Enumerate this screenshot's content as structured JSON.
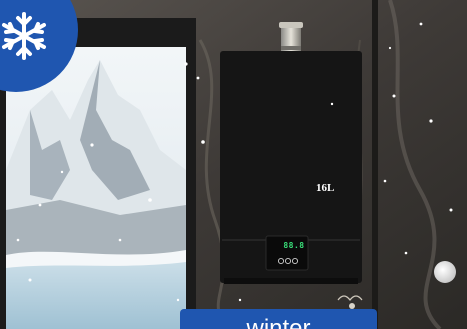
{
  "caption": {
    "label": "winter"
  },
  "heater": {
    "capacity_label": "16L",
    "display_readout": "88.8"
  },
  "badge": {
    "icon": "snowflake-icon",
    "color": "#1f56b0"
  },
  "colors": {
    "sky": "#e6eef2",
    "mountain_shadow": "#9aa6b0",
    "heater_body": "#151515",
    "display_digits": "#39e07a",
    "wall_stone": "#4a4642"
  }
}
